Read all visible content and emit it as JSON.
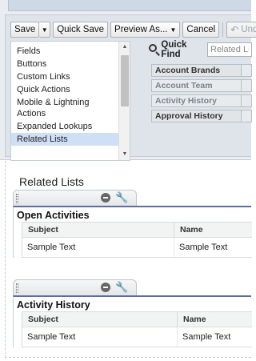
{
  "toolbar": {
    "save_label": "Save",
    "quick_save_label": "Quick Save",
    "preview_as_label": "Preview As...",
    "cancel_label": "Cancel",
    "undo_label": "Und"
  },
  "categories": {
    "items": [
      {
        "label": "Fields"
      },
      {
        "label": "Buttons"
      },
      {
        "label": "Custom Links"
      },
      {
        "label": "Quick Actions"
      },
      {
        "label": "Mobile & Lightning Actions"
      },
      {
        "label": "Expanded Lookups"
      },
      {
        "label": "Related Lists"
      }
    ],
    "selected": "Related Lists"
  },
  "palette": {
    "quick_find_label": "Quick Find",
    "quick_find_value": "Related Li",
    "items": [
      {
        "label": "Account Brands"
      },
      {
        "label": "Account Team"
      },
      {
        "label": "Activity History"
      },
      {
        "label": "Approval History"
      }
    ]
  },
  "layout": {
    "section_title": "Related Lists",
    "related_lists": [
      {
        "title": "Open Activities",
        "columns": [
          "Subject",
          "Name"
        ],
        "rows": [
          [
            "Sample Text",
            "Sample Text"
          ]
        ]
      },
      {
        "title": "Activity History",
        "columns": [
          "Subject",
          "Name"
        ],
        "rows": [
          [
            "Sample Text",
            "Sample Text"
          ]
        ]
      }
    ]
  },
  "icons": {
    "undo": "undo-icon",
    "search": "search-icon",
    "remove": "minus-circle-icon",
    "properties": "wrench-icon",
    "drag": "drag-handle-icon"
  },
  "colors": {
    "header_rule": "#5a6f9e",
    "selected_item": "#cfe0f6"
  }
}
